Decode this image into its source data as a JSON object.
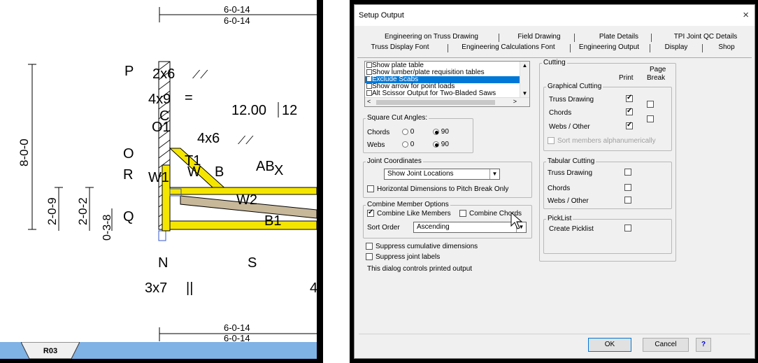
{
  "truss": {
    "dim_top_1": "6-0-14",
    "dim_top_2": "6-0-14",
    "dim_bottom_1": "6-0-14",
    "dim_bottom_2": "6-0-14",
    "dim_height": "8-0-0",
    "dim_a": "2-0-9",
    "dim_b": "2-0-2",
    "dim_c": "0-3-8",
    "pitch": "12.00",
    "pitch_right": "12",
    "labels": {
      "P": "P",
      "O": "O",
      "R": "R",
      "Q": "Q",
      "N": "N",
      "S": "S",
      "C": "C",
      "O1": "O1",
      "T1": "T1",
      "W1": "W1",
      "W": "W",
      "B": "B",
      "AB": "AB",
      "X": "X",
      "W2": "W2",
      "B1": "B1"
    },
    "plates": {
      "p1": "2x6",
      "p2": "4x9",
      "p3": "4x6",
      "p4": "3x7",
      "p4_mark": "||",
      "p2_mark": "=",
      "right_cut": "4"
    },
    "tab_label": "R03"
  },
  "dialog": {
    "title": "Setup Output",
    "close": "×",
    "tabs_back": [
      "Engineering on Truss Drawing",
      "Field Drawing",
      "Plate Details",
      "TPI Joint QC Details"
    ],
    "tabs_front": [
      "Truss Display Font",
      "Engineering Calculations Font",
      "Engineering Output",
      "Display",
      "Shop"
    ],
    "list_items": [
      {
        "label": "Show plate table",
        "checked": false,
        "selected": false
      },
      {
        "label": "Show lumber/plate requisition tables",
        "checked": false,
        "selected": false
      },
      {
        "label": "Exclude Scabs",
        "checked": true,
        "selected": true
      },
      {
        "label": "Show arrow for point loads",
        "checked": false,
        "selected": false
      },
      {
        "label": "Alt Scissor Output for Two-Bladed Saws",
        "checked": false,
        "selected": false
      }
    ],
    "square_cut": {
      "title": "Square Cut Angles:",
      "rows": [
        {
          "label": "Chords",
          "opt1": "0",
          "opt2": "90",
          "selected": "90"
        },
        {
          "label": "Webs",
          "opt1": "0",
          "opt2": "90",
          "selected": "90"
        }
      ]
    },
    "joint_coords": {
      "title": "Joint Coordinates",
      "combo_value": "Show Joint Locations",
      "checkbox_label": "Horizontal Dimensions to Pitch Break Only",
      "checked": false
    },
    "combine": {
      "title": "Combine Member Options",
      "like_label": "Combine Like Members",
      "like_checked": true,
      "chords_label": "Combine Chords",
      "chords_checked": false,
      "sort_label": "Sort Order",
      "sort_value": "Ascending"
    },
    "suppress_cum": "Suppress cumulative dimensions",
    "suppress_joint": "Suppress joint labels",
    "help_text": "This dialog controls printed output",
    "cutting": {
      "title": "Cutting",
      "col_print": "Print",
      "col_page": "Page",
      "col_break": "Break",
      "graphical": {
        "title": "Graphical Cutting",
        "rows": [
          {
            "label": "Truss Drawing",
            "print": true
          },
          {
            "label": "Chords",
            "print": true,
            "page": false
          },
          {
            "label": "Webs / Other",
            "print": true,
            "page": false
          }
        ],
        "sort_label": "Sort members alphanumerically"
      },
      "tabular": {
        "title": "Tabular Cutting",
        "rows": [
          {
            "label": "Truss Drawing",
            "print": false
          },
          {
            "label": "Chords",
            "print": false
          },
          {
            "label": "Webs / Other",
            "print": false
          }
        ]
      },
      "picklist": {
        "title": "PickList",
        "label": "Create Picklist",
        "checked": false
      }
    },
    "buttons": {
      "ok": "OK",
      "cancel": "Cancel",
      "help": "?"
    },
    "colors": {
      "selection": "#0078d7",
      "truss_member": "#f5e600",
      "truss_member_alt": "#c8b89a"
    }
  }
}
